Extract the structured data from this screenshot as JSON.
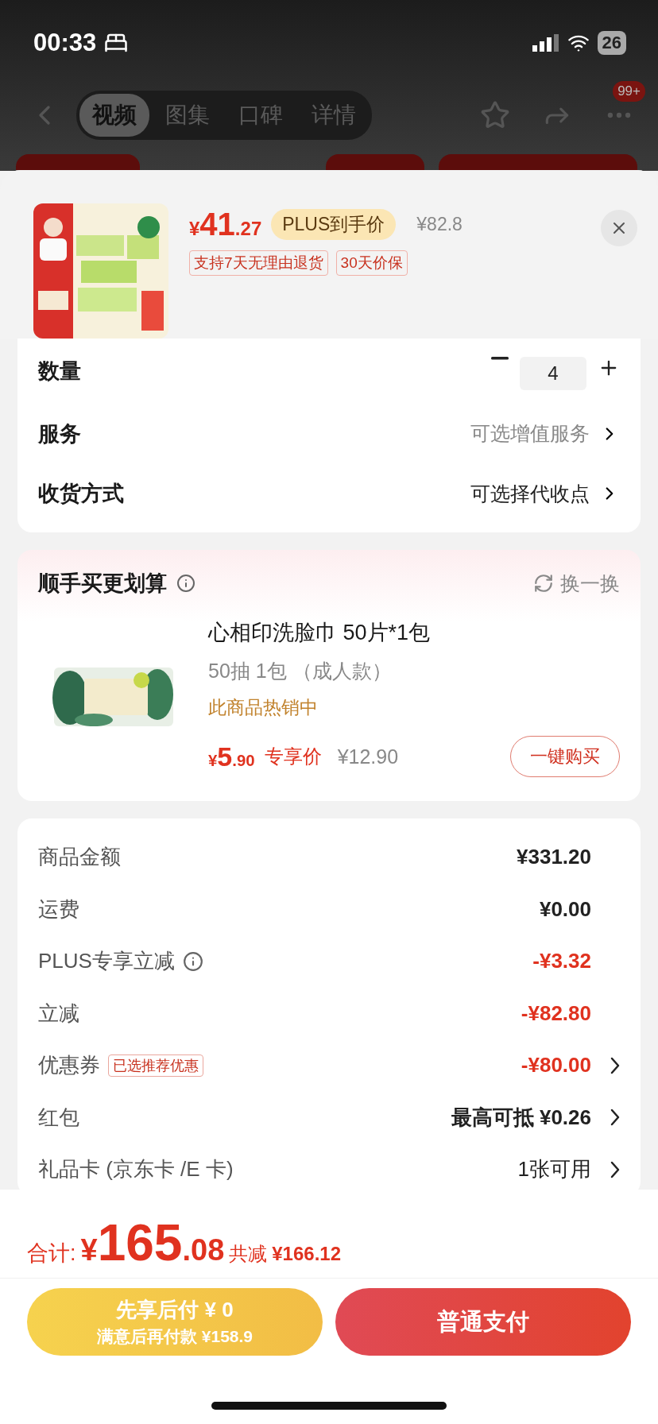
{
  "status_bar": {
    "time": "00:33",
    "battery": "26"
  },
  "nav": {
    "tabs": [
      {
        "label": "视频",
        "selected": true
      },
      {
        "label": "图集",
        "selected": false
      },
      {
        "label": "口碑",
        "selected": false
      },
      {
        "label": "详情",
        "selected": false
      }
    ],
    "badge": "99+"
  },
  "product": {
    "price": {
      "currency": "¥",
      "integer": "41",
      "decimal": ".27"
    },
    "price_badge": "PLUS到手价",
    "original_price": "¥82.8",
    "tags": [
      "支持7天无理由退货",
      "30天价保"
    ]
  },
  "options": {
    "quantity": {
      "label": "数量",
      "value": "4"
    },
    "rows": [
      {
        "label": "服务",
        "value": "可选增值服务"
      },
      {
        "label": "收货方式",
        "value": "可选择代收点"
      }
    ]
  },
  "addon": {
    "title": "顺手买更划算",
    "refresh": "换一换",
    "name": "心相印洗脸巾 50片*1包",
    "spec": "50抽 1包 （成人款）",
    "hot": "此商品热销中",
    "price": {
      "currency": "¥",
      "integer": "5",
      "decimal": ".90"
    },
    "price_label": "专享价",
    "original_price": "¥12.90",
    "buy": "一键购买"
  },
  "summary": [
    {
      "label": "商品金额",
      "value": "¥331.20",
      "kind": "amount",
      "chevron": false
    },
    {
      "label": "运费",
      "value": "¥0.00",
      "kind": "amount",
      "chevron": false
    },
    {
      "label": "PLUS专享立减",
      "info": true,
      "value": "-¥3.32",
      "kind": "discount",
      "chevron": false
    },
    {
      "label": "立减",
      "value": "-¥82.80",
      "kind": "discount",
      "chevron": false
    },
    {
      "label": "优惠券",
      "tag": "已选推荐优惠",
      "value": "-¥80.00",
      "kind": "discount",
      "chevron": true
    },
    {
      "label": "红包",
      "value": "最高可抵 ¥0.26",
      "kind": "amount",
      "chevron": true
    },
    {
      "label": "礼品卡 (京东卡 /E 卡)",
      "value": "1张可用",
      "kind": "plain",
      "chevron": true
    }
  ],
  "total": {
    "label": "合计:",
    "currency": "¥",
    "integer": "165",
    "decimal": ".08",
    "saved_label": "共减",
    "saved": "¥166.12"
  },
  "buttons": {
    "pay_later": {
      "title": "先享后付 ¥ 0",
      "subtitle": "满意后再付款 ¥158.9"
    },
    "pay": "普通支付"
  }
}
